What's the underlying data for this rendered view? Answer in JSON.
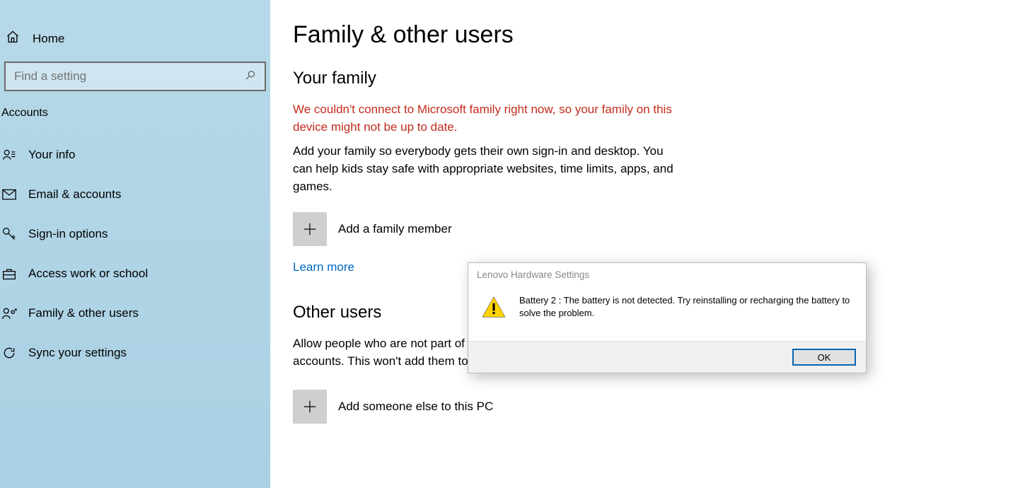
{
  "sidebar": {
    "home_label": "Home",
    "search_placeholder": "Find a setting",
    "section_label": "Accounts",
    "items": [
      {
        "label": "Your info"
      },
      {
        "label": "Email & accounts"
      },
      {
        "label": "Sign-in options"
      },
      {
        "label": "Access work or school"
      },
      {
        "label": "Family & other users"
      },
      {
        "label": "Sync your settings"
      }
    ]
  },
  "page": {
    "title": "Family & other users",
    "family_heading": "Your family",
    "family_error": "We couldn't connect to Microsoft family right now, so your family on this device might not be up to date.",
    "family_desc": "Add your family so everybody gets their own sign-in and desktop. You can help kids stay safe with appropriate websites, time limits, apps, and games.",
    "add_family_label": "Add a family member",
    "learn_more": "Learn more",
    "other_heading": "Other users",
    "other_desc_visible": "Allow people who who are not part\nown accounts. This won't add",
    "other_desc": "Allow people who are not part of your family to sign in with their own accounts. This won't add them to your family.",
    "add_other_label": "Add someone else to this PC"
  },
  "dialog": {
    "title": "Lenovo Hardware Settings",
    "message": "Battery 2 : The battery is not detected. Try reinstalling or recharging the battery to solve the problem.",
    "ok_label": "OK"
  }
}
